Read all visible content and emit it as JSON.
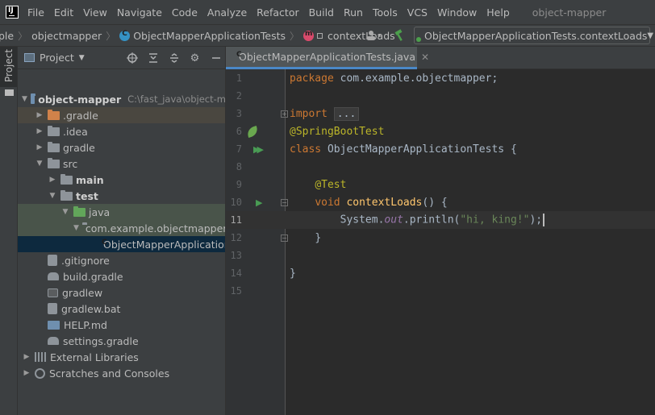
{
  "app": {
    "logo_text": "IJ",
    "menu": [
      "File",
      "Edit",
      "View",
      "Navigate",
      "Code",
      "Analyze",
      "Refactor",
      "Build",
      "Run",
      "Tools",
      "VCS",
      "Window",
      "Help"
    ],
    "window_title": "object-mapper"
  },
  "breadcrumb": {
    "items": [
      "ple",
      "objectmapper",
      "ObjectMapperApplicationTests",
      "contextLoads"
    ]
  },
  "run_config": {
    "label": "ObjectMapperApplicationTests.contextLoads"
  },
  "stripe": {
    "label": "Project"
  },
  "project_panel": {
    "title": "Project",
    "root": {
      "name": "object-mapper",
      "path": "C:\\fast_java\\object-m"
    },
    "items": [
      {
        "label": ".gradle",
        "kind": "folder-orange"
      },
      {
        "label": ".idea",
        "kind": "folder"
      },
      {
        "label": "gradle",
        "kind": "folder"
      },
      {
        "label": "src",
        "kind": "folder"
      },
      {
        "label": "main",
        "kind": "folder"
      },
      {
        "label": "test",
        "kind": "folder"
      },
      {
        "label": "java",
        "kind": "folder-green"
      },
      {
        "label": "com.example.objectmapper",
        "kind": "package"
      },
      {
        "label": "ObjectMapperApplicationTests",
        "kind": "class"
      },
      {
        "label": ".gitignore",
        "kind": "file"
      },
      {
        "label": "build.gradle",
        "kind": "gradle"
      },
      {
        "label": "gradlew",
        "kind": "script"
      },
      {
        "label": "gradlew.bat",
        "kind": "file"
      },
      {
        "label": "HELP.md",
        "kind": "md"
      },
      {
        "label": "settings.gradle",
        "kind": "gradle"
      },
      {
        "label": "External Libraries",
        "kind": "libs"
      },
      {
        "label": "Scratches and Consoles",
        "kind": "scratch"
      }
    ]
  },
  "editor": {
    "tab_label": "ObjectMapperApplicationTests.java",
    "line_numbers": [
      "1",
      "2",
      "3",
      "6",
      "7",
      "8",
      "9",
      "10",
      "11",
      "12",
      "13",
      "14",
      "15"
    ],
    "code": {
      "l1_kw": "package",
      "l1_rest": " com.example.objectmapper;",
      "l3_kw": "import",
      "l3_fold": "...",
      "l6_ann": "@SpringBootTest",
      "l7_kw": "class",
      "l7_rest": " ObjectMapperApplicationTests {",
      "l9_ann": "@Test",
      "l10_kw": "void",
      "l10_fn": "contextLoads",
      "l10_rest": "() {",
      "l11_a": "System.",
      "l11_out": "out",
      "l11_b": ".println(",
      "l11_str": "\"hi, king!\"",
      "l11_c": ");",
      "l12": "}",
      "l14": "}"
    }
  },
  "colors": {
    "keyword": "#cc7832",
    "annotation": "#bbb529",
    "string": "#6a8759",
    "function": "#ffc66d",
    "static_field": "#9876aa",
    "selection": "#0d293e",
    "tab_underline": "#4a88c7"
  }
}
